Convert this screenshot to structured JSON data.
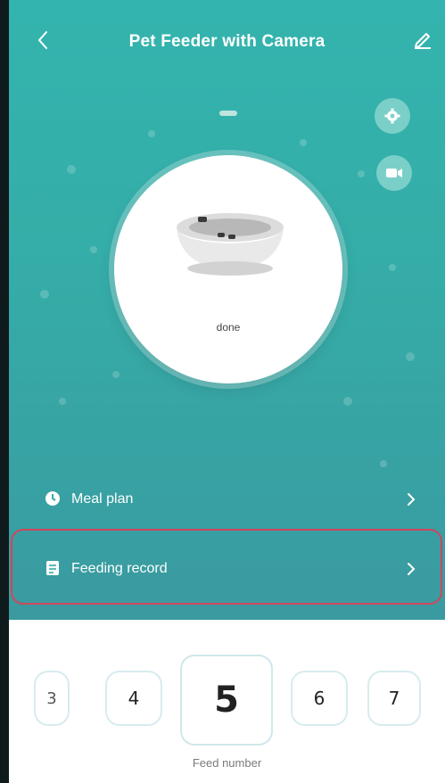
{
  "header": {
    "title": "Pet Feeder with Camera",
    "back_icon": "back-arrow-icon",
    "edit_icon": "edit-pencil-icon"
  },
  "device": {
    "status_text": "done",
    "settings_icon": "gear-icon",
    "camera_icon": "video-camera-icon"
  },
  "menu": {
    "meal_plan_label": "Meal plan",
    "feeding_record_label": "Feeding record"
  },
  "feed": {
    "numbers": [
      "3",
      "4",
      "5",
      "6",
      "7"
    ],
    "selected": "5",
    "label": "Feed number"
  },
  "colors": {
    "teal": "#35aca7",
    "highlight": "#d0465c"
  }
}
